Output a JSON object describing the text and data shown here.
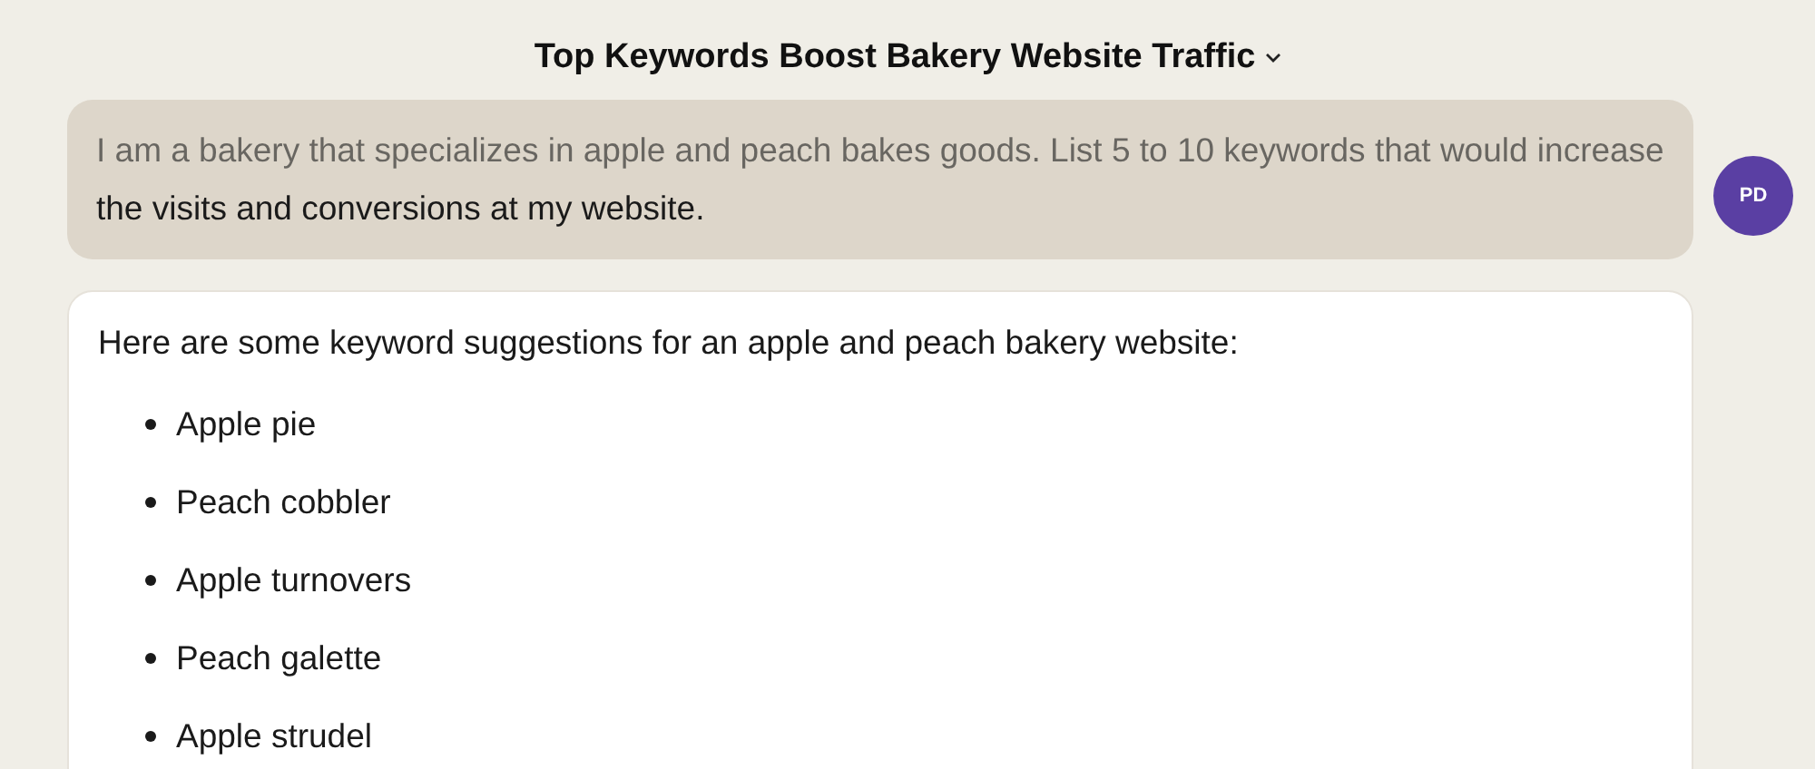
{
  "conversation": {
    "title": "Top Keywords Boost Bakery Website Traffic"
  },
  "user_message": {
    "text": "I am a bakery that specializes in apple and peach bakes goods. List 5 to 10 keywords that would increase the visits and conversions at my website.",
    "avatar_initials": "PD"
  },
  "response": {
    "intro": "Here are some keyword suggestions for an apple and peach bakery website:",
    "items": [
      "Apple pie",
      "Peach cobbler",
      "Apple turnovers",
      "Peach galette",
      "Apple strudel"
    ]
  }
}
